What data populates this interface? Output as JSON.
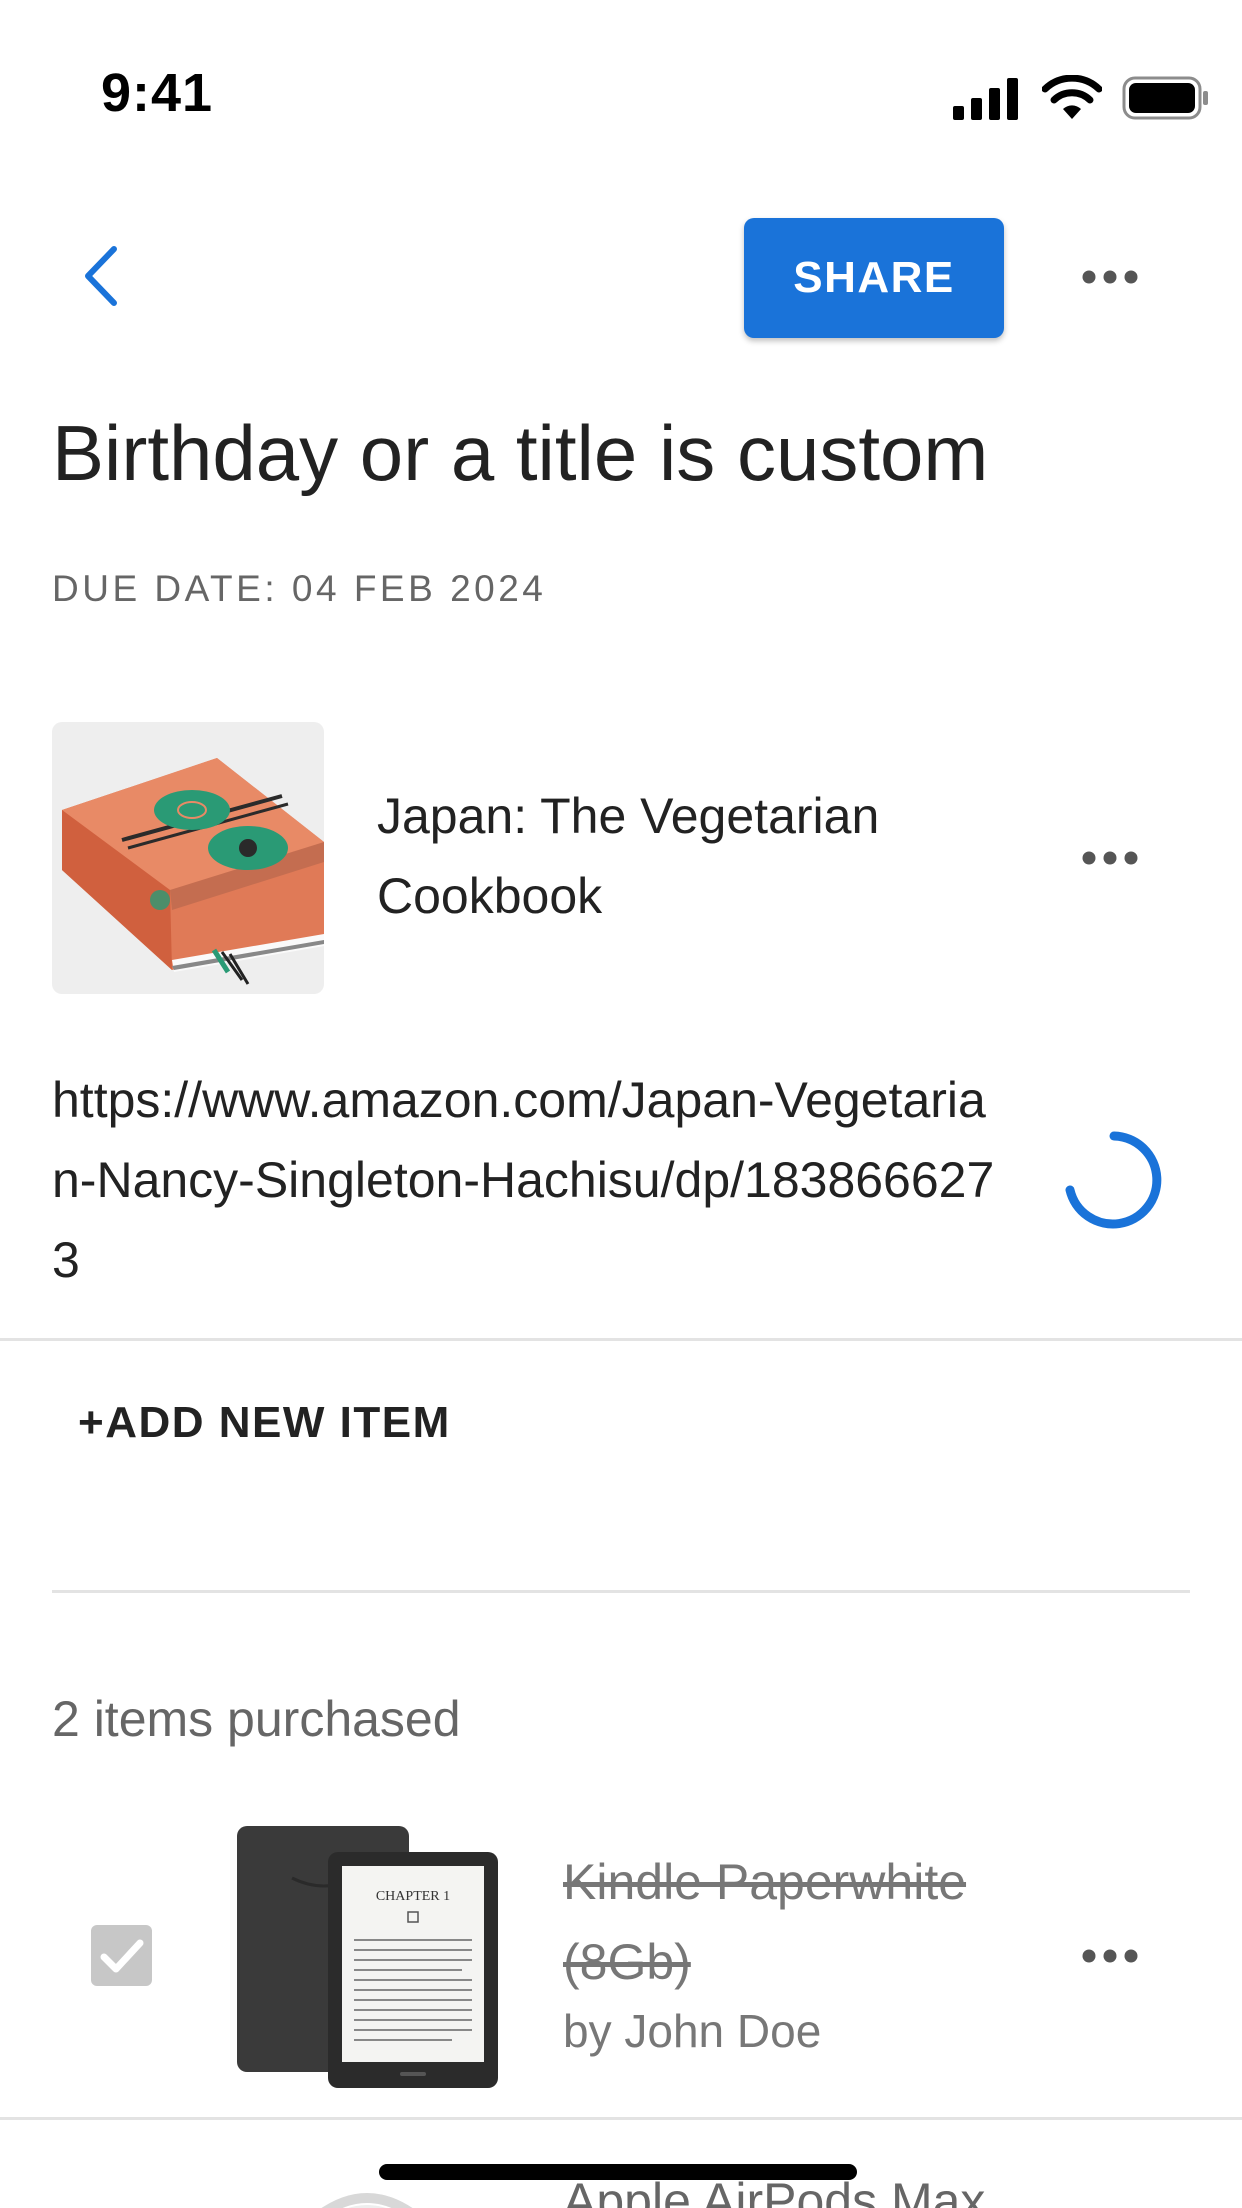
{
  "status_bar": {
    "time": "9:41"
  },
  "toolbar": {
    "share_label": "SHARE"
  },
  "list": {
    "title": "Birthday or a title is custom",
    "due_date": "DUE DATE: 04 FEB 2024"
  },
  "item": {
    "title": "Japan: The Vegetarian Cookbook",
    "url": "https://www.amazon.com/Japan-Vegetarian-Nancy-Singleton-Hachisu/dp/1838666273"
  },
  "add_item_label": "+ADD NEW ITEM",
  "purchased": {
    "count_label": "2 items purchased",
    "items": [
      {
        "title": "Kindle Paperwhite (8Gb)",
        "by": "by John Doe",
        "checked": true
      },
      {
        "title": "Apple AirPods Max"
      }
    ]
  },
  "colors": {
    "accent": "#1a73d9",
    "text": "#212121",
    "muted": "#666666",
    "divider": "#e3e3e3"
  }
}
